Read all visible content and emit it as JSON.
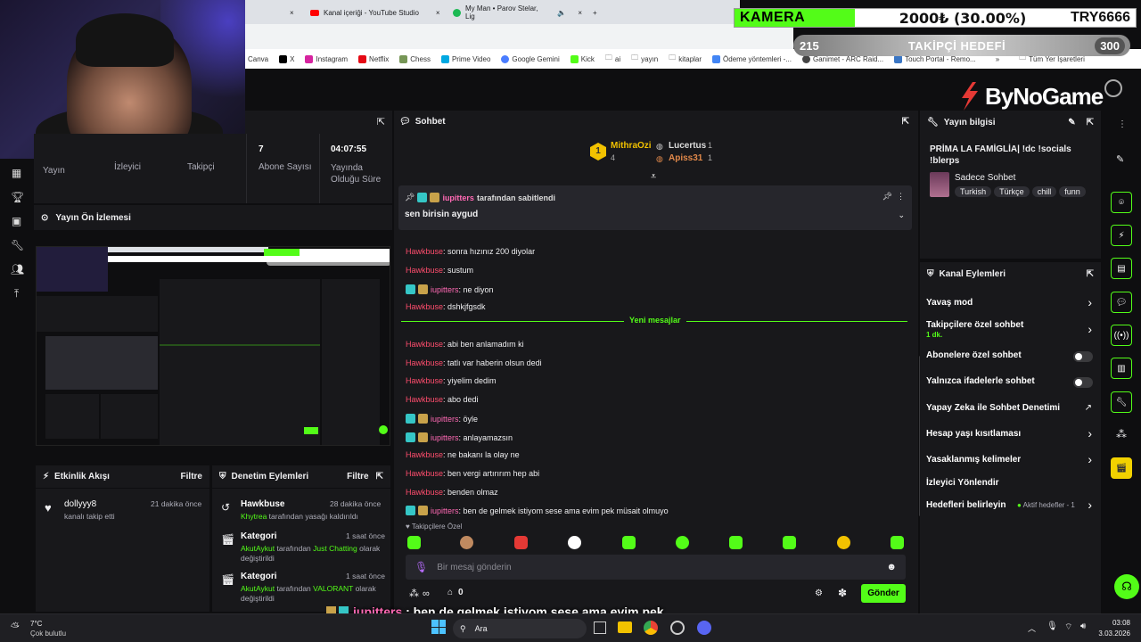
{
  "browser": {
    "tabs": [
      {
        "label": "Kanal içeriği - YouTube Studio"
      },
      {
        "label": "My Man • Parov Stelar, Lig"
      }
    ],
    "bookmarks": [
      "Canva",
      "X",
      "Instagram",
      "Netflix",
      "Chess",
      "Prime Video",
      "Google Gemini",
      "Kick",
      "ai",
      "yayın",
      "kitaplar",
      "Ödeme yöntemleri -...",
      "Ganimet - ARC Raid...",
      "Touch Portal - Remo..."
    ],
    "all_bookmarks": "Tüm Yer İşaretleri"
  },
  "overlay": {
    "camera_label": "KAMERA",
    "camera_amount": "2000₺ (30.00%)",
    "camera_code": "TRY6666",
    "goal_current": "215",
    "goal_title": "TAKİPÇİ HEDEFİ",
    "goal_target": "300",
    "logo_text": "ByNoGame",
    "bottom_user": "iupitters",
    "bottom_text": " : ben de gelmek istiyom sese ama evim pek müsait olmuyo"
  },
  "stats": {
    "labels": [
      "Yayın",
      "İzleyici",
      "Takipçi",
      "Abone Sayısı",
      "Yayında Olduğu Süre"
    ],
    "subs_value": "7",
    "uptime_value": "04:07:55"
  },
  "preview": {
    "title": "Yayın Ön İzlemesi"
  },
  "activity": {
    "title": "Etkinlik Akışı",
    "filter": "Filtre",
    "items": [
      {
        "user": "dollyyy8",
        "text": "kanalı takip etti",
        "time": "21 dakika önce"
      }
    ]
  },
  "moderation": {
    "title": "Denetim Eylemleri",
    "filter": "Filtre",
    "items": [
      {
        "title": "Hawkbuse",
        "time": "28 dakika önce",
        "actor": "Khytrea",
        "text": "tarafından yasağı kaldırıldı",
        "extra": ""
      },
      {
        "title": "Kategori",
        "time": "1 saat önce",
        "actor": "AkutAykut",
        "text": "tarafından",
        "extra": "Just Chatting",
        "tail": "olarak değiştirildi"
      },
      {
        "title": "Kategori",
        "time": "1 saat önce",
        "actor": "AkutAykut",
        "text": "tarafından",
        "extra": "VALORANT",
        "tail": "olarak değiştirildi"
      }
    ]
  },
  "chat": {
    "title": "Sohbet",
    "top_users": [
      {
        "name": "MithraOzi",
        "count": "4"
      },
      {
        "name": "Lucertus",
        "count": "1"
      },
      {
        "name": "Apiss31",
        "count": "1"
      }
    ],
    "pinned_by": "iupitters",
    "pinned_label": "tarafından sabitlendi",
    "pinned_text": "sen birisin aygud",
    "new_messages": "Yeni mesajlar",
    "messages": [
      {
        "user": "Hawkbuse",
        "text": ": sonra hızınız 200 diyolar",
        "kind": "h"
      },
      {
        "user": "Hawkbuse",
        "text": ": sustum",
        "kind": "h"
      },
      {
        "user": "iupitters",
        "text": ": ne diyon",
        "kind": "i"
      },
      {
        "user": "Hawkbuse",
        "text": ": dshkjfgsdk",
        "kind": "h"
      },
      {
        "user": "Hawkbuse",
        "text": ": abi ben anlamadım ki",
        "kind": "h"
      },
      {
        "user": "Hawkbuse",
        "text": ": tatlı var haberin olsun dedi",
        "kind": "h"
      },
      {
        "user": "Hawkbuse",
        "text": ": yiyelim dedim",
        "kind": "h"
      },
      {
        "user": "Hawkbuse",
        "text": ": abo dedi",
        "kind": "h"
      },
      {
        "user": "iupitters",
        "text": ": öyle",
        "kind": "i"
      },
      {
        "user": "iupitters",
        "text": ": anlayamazsın",
        "kind": "i"
      },
      {
        "user": "Hawkbuse",
        "text": ": ne bakanı la olay ne",
        "kind": "h"
      },
      {
        "user": "Hawkbuse",
        "text": ": ben vergi artırırım hep abi",
        "kind": "h"
      },
      {
        "user": "Hawkbuse",
        "text": ": benden olmaz",
        "kind": "h"
      },
      {
        "user": "iupitters",
        "text": ": ben de gelmek istiyom sese ama evim pek müsait olmuyo",
        "kind": "i"
      }
    ],
    "followers_only_label": "Takipçilere Özel",
    "input_placeholder": "Bir mesaj gönderin",
    "points": "∞",
    "count": "0",
    "send": "Gönder"
  },
  "stream_info": {
    "title": "Yayın bilgisi",
    "stream_title": "PRİMA LA FAMİGLİA| !dc !socials !blerps",
    "category": "Sadece Sohbet",
    "tags": [
      "Turkish",
      "Türkçe",
      "chill",
      "funn"
    ]
  },
  "channel_actions": {
    "title": "Kanal Eylemleri",
    "items": [
      {
        "label": "Yavaş mod",
        "type": "chev"
      },
      {
        "label": "Takipçilere özel sohbet",
        "sub": "1 dk.",
        "type": "chev"
      },
      {
        "label": "Abonelere özel sohbet",
        "type": "toggle"
      },
      {
        "label": "Yalnızca ifadelerle sohbet",
        "type": "toggle"
      },
      {
        "label": "Yapay Zeka ile Sohbet Denetimi",
        "type": "ext"
      },
      {
        "label": "Hesap yaşı kısıtlaması",
        "type": "chev"
      },
      {
        "label": "Yasaklanmış kelimeler",
        "type": "chev"
      },
      {
        "label": "İzleyici Yönlendir",
        "type": "none"
      },
      {
        "label": "Hedefleri belirleyin",
        "sub": "Aktif hedefler - 1",
        "type": "chev"
      }
    ]
  },
  "taskbar": {
    "temp": "7°C",
    "weather": "Çok bulutlu",
    "search": "Ara",
    "time": "03:08",
    "date": "3.03.2026"
  },
  "colors": {
    "accent": "#53fc18",
    "bg": "#0e0e10",
    "panel": "#18181b",
    "user_red": "#ff4d6d",
    "user_pink": "#ff69b4"
  }
}
